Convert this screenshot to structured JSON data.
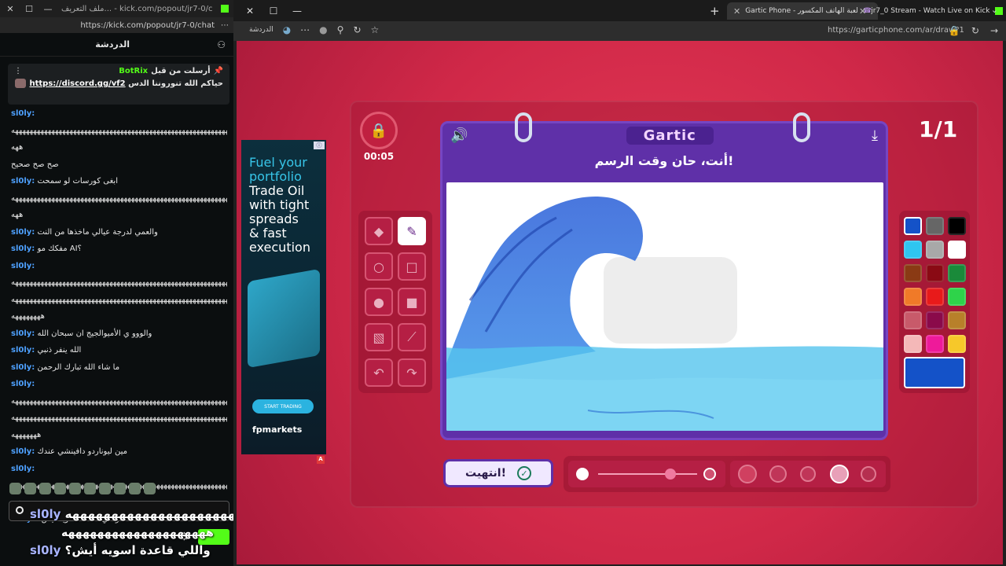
{
  "kick": {
    "window_title": "ملف التعريف... - kick.com/popout/jr7-0/chat",
    "url": "https://kick.com/popout/jr7-0/chat",
    "header_title": "الدردشة",
    "pinned": {
      "sender": "BotRix",
      "label": "أرسلت من قبل",
      "message_prefix": "حياكم الله تنوروننا الدس",
      "link": "https://discord.gg/vf2"
    },
    "messages": [
      {
        "user": "sl0ly:",
        "text": ""
      },
      {
        "user": "",
        "text": "ههههههههههههههههههههههههههههههههههههههههههههههههههههههههههههه"
      },
      {
        "user": "",
        "text": "ههه"
      },
      {
        "user": "",
        "text": "صح صح صحيح"
      },
      {
        "user": "sl0ly:",
        "text": "ابغى كورسات لو سمحت"
      },
      {
        "user": "",
        "text": "ههههههههههههههههههههههههههههههههههههههههههههههههههههههههههههه"
      },
      {
        "user": "",
        "text": "ههه"
      },
      {
        "user": "sl0ly:",
        "text": "والعمي لدرجة عيالي ماخذها من النت"
      },
      {
        "user": "sl0ly:",
        "text": "مفكك مو AI؟"
      },
      {
        "user": "sl0ly:",
        "text": ""
      },
      {
        "user": "",
        "text": "ههههههههههههههههههههههههههههههههههههههههههههههههههههههههههههه"
      },
      {
        "user": "",
        "text": "ههههههههههههههههههههههههههههههههههههههههههههههههههههههههههههه"
      },
      {
        "user": "",
        "text": "ههههههههه"
      },
      {
        "user": "sl0ly:",
        "text": "والووو ي الأميوالجيج ان سبحان الله"
      },
      {
        "user": "sl0ly:",
        "text": "الله ينفر ذنبي"
      },
      {
        "user": "sl0ly:",
        "text": "ما شاء الله تبارك الرحمن"
      },
      {
        "user": "sl0ly:",
        "text": ""
      },
      {
        "user": "",
        "text": "ههههههههههههههههههههههههههههههههههههههههههههههههههههههههههههه"
      },
      {
        "user": "",
        "text": "ههههههههههههههههههههههههههههههههههههههههههههههههههههههههههههه"
      },
      {
        "user": "",
        "text": "هههههههه"
      },
      {
        "user": "sl0ly:",
        "text": "مين ليوناردو دافينشي عندك"
      },
      {
        "user": "sl0ly:",
        "text": ""
      },
      {
        "user": "",
        "text": "ههههههههههههههههههههههههههههههههههههههههههههههههههههههههههههه"
      },
      {
        "user": "",
        "text": "ههه"
      },
      {
        "user": "sl0ly:",
        "text": "واللي قاعدة اسويه أيش؟"
      }
    ],
    "overlay_user": "sl0ly",
    "overlay_line1": "ههههههههههههههههههههههههههههه",
    "overlay_line2": "ههههههههههههههههههههه",
    "overlay_line3": "واللي قاعدة اسويه أيش؟"
  },
  "browser": {
    "tabs": [
      {
        "label": "Gartic Phone - لعبة الهاتف المكسور",
        "active": true
      },
      {
        "label": "jr7_0 Stream - Watch Live on Kick",
        "active": false
      }
    ],
    "url": "https://garticphone.com/ar/draw?1",
    "chat_label": "الدردشة"
  },
  "game": {
    "timer": "00:05",
    "round": "1/1",
    "brand": "Gartic",
    "prompt": "أنت، حان وقت الرسم!",
    "done_label": "انتهيت!",
    "tools": [
      "eraser-tool",
      "pencil-tool",
      "circle-outline-tool",
      "rect-outline-tool",
      "circle-fill-tool",
      "rect-fill-tool",
      "bucket-tool",
      "line-tool",
      "undo-tool",
      "redo-tool"
    ],
    "colors": [
      "#1452c8",
      "#666666",
      "#000000",
      "#2fc6f0",
      "#a8a8a8",
      "#ffffff",
      "#8a3a14",
      "#8a0a14",
      "#1a8a3a",
      "#f07a28",
      "#e81a1a",
      "#2ed34a",
      "#c85a6a",
      "#8a0a4a",
      "#b8802a",
      "#f4b8b8",
      "#ee1a9a",
      "#f6c82a"
    ],
    "selected_color": "#1452c8"
  },
  "ad": {
    "line1": "Fuel your",
    "line2": "portfolio",
    "line3": "Trade Oil",
    "line4": "with tight",
    "line5": "spreads",
    "line6": "& fast",
    "line7": "execution",
    "cta": "START TRADING",
    "brand": "fpmarkets"
  }
}
